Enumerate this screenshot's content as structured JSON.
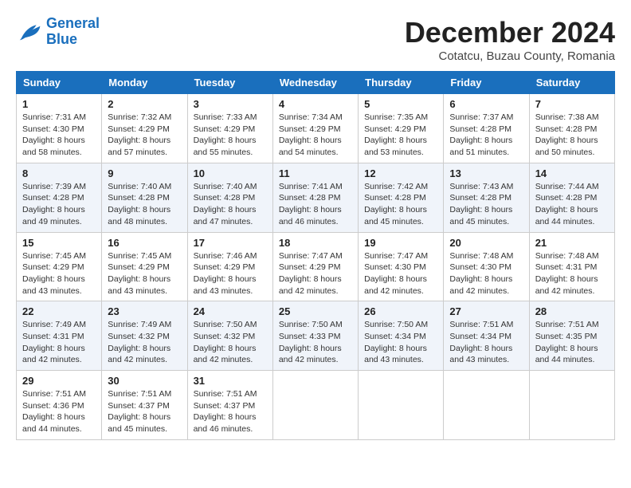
{
  "logo": {
    "line1": "General",
    "line2": "Blue"
  },
  "title": "December 2024",
  "subtitle": "Cotatcu, Buzau County, Romania",
  "weekdays": [
    "Sunday",
    "Monday",
    "Tuesday",
    "Wednesday",
    "Thursday",
    "Friday",
    "Saturday"
  ],
  "weeks": [
    [
      {
        "day": "1",
        "sunrise": "7:31 AM",
        "sunset": "4:30 PM",
        "daylight": "8 hours and 58 minutes."
      },
      {
        "day": "2",
        "sunrise": "7:32 AM",
        "sunset": "4:29 PM",
        "daylight": "8 hours and 57 minutes."
      },
      {
        "day": "3",
        "sunrise": "7:33 AM",
        "sunset": "4:29 PM",
        "daylight": "8 hours and 55 minutes."
      },
      {
        "day": "4",
        "sunrise": "7:34 AM",
        "sunset": "4:29 PM",
        "daylight": "8 hours and 54 minutes."
      },
      {
        "day": "5",
        "sunrise": "7:35 AM",
        "sunset": "4:29 PM",
        "daylight": "8 hours and 53 minutes."
      },
      {
        "day": "6",
        "sunrise": "7:37 AM",
        "sunset": "4:28 PM",
        "daylight": "8 hours and 51 minutes."
      },
      {
        "day": "7",
        "sunrise": "7:38 AM",
        "sunset": "4:28 PM",
        "daylight": "8 hours and 50 minutes."
      }
    ],
    [
      {
        "day": "8",
        "sunrise": "7:39 AM",
        "sunset": "4:28 PM",
        "daylight": "8 hours and 49 minutes."
      },
      {
        "day": "9",
        "sunrise": "7:40 AM",
        "sunset": "4:28 PM",
        "daylight": "8 hours and 48 minutes."
      },
      {
        "day": "10",
        "sunrise": "7:40 AM",
        "sunset": "4:28 PM",
        "daylight": "8 hours and 47 minutes."
      },
      {
        "day": "11",
        "sunrise": "7:41 AM",
        "sunset": "4:28 PM",
        "daylight": "8 hours and 46 minutes."
      },
      {
        "day": "12",
        "sunrise": "7:42 AM",
        "sunset": "4:28 PM",
        "daylight": "8 hours and 45 minutes."
      },
      {
        "day": "13",
        "sunrise": "7:43 AM",
        "sunset": "4:28 PM",
        "daylight": "8 hours and 45 minutes."
      },
      {
        "day": "14",
        "sunrise": "7:44 AM",
        "sunset": "4:28 PM",
        "daylight": "8 hours and 44 minutes."
      }
    ],
    [
      {
        "day": "15",
        "sunrise": "7:45 AM",
        "sunset": "4:29 PM",
        "daylight": "8 hours and 43 minutes."
      },
      {
        "day": "16",
        "sunrise": "7:45 AM",
        "sunset": "4:29 PM",
        "daylight": "8 hours and 43 minutes."
      },
      {
        "day": "17",
        "sunrise": "7:46 AM",
        "sunset": "4:29 PM",
        "daylight": "8 hours and 43 minutes."
      },
      {
        "day": "18",
        "sunrise": "7:47 AM",
        "sunset": "4:29 PM",
        "daylight": "8 hours and 42 minutes."
      },
      {
        "day": "19",
        "sunrise": "7:47 AM",
        "sunset": "4:30 PM",
        "daylight": "8 hours and 42 minutes."
      },
      {
        "day": "20",
        "sunrise": "7:48 AM",
        "sunset": "4:30 PM",
        "daylight": "8 hours and 42 minutes."
      },
      {
        "day": "21",
        "sunrise": "7:48 AM",
        "sunset": "4:31 PM",
        "daylight": "8 hours and 42 minutes."
      }
    ],
    [
      {
        "day": "22",
        "sunrise": "7:49 AM",
        "sunset": "4:31 PM",
        "daylight": "8 hours and 42 minutes."
      },
      {
        "day": "23",
        "sunrise": "7:49 AM",
        "sunset": "4:32 PM",
        "daylight": "8 hours and 42 minutes."
      },
      {
        "day": "24",
        "sunrise": "7:50 AM",
        "sunset": "4:32 PM",
        "daylight": "8 hours and 42 minutes."
      },
      {
        "day": "25",
        "sunrise": "7:50 AM",
        "sunset": "4:33 PM",
        "daylight": "8 hours and 42 minutes."
      },
      {
        "day": "26",
        "sunrise": "7:50 AM",
        "sunset": "4:34 PM",
        "daylight": "8 hours and 43 minutes."
      },
      {
        "day": "27",
        "sunrise": "7:51 AM",
        "sunset": "4:34 PM",
        "daylight": "8 hours and 43 minutes."
      },
      {
        "day": "28",
        "sunrise": "7:51 AM",
        "sunset": "4:35 PM",
        "daylight": "8 hours and 44 minutes."
      }
    ],
    [
      {
        "day": "29",
        "sunrise": "7:51 AM",
        "sunset": "4:36 PM",
        "daylight": "8 hours and 44 minutes."
      },
      {
        "day": "30",
        "sunrise": "7:51 AM",
        "sunset": "4:37 PM",
        "daylight": "8 hours and 45 minutes."
      },
      {
        "day": "31",
        "sunrise": "7:51 AM",
        "sunset": "4:37 PM",
        "daylight": "8 hours and 46 minutes."
      },
      null,
      null,
      null,
      null
    ]
  ]
}
